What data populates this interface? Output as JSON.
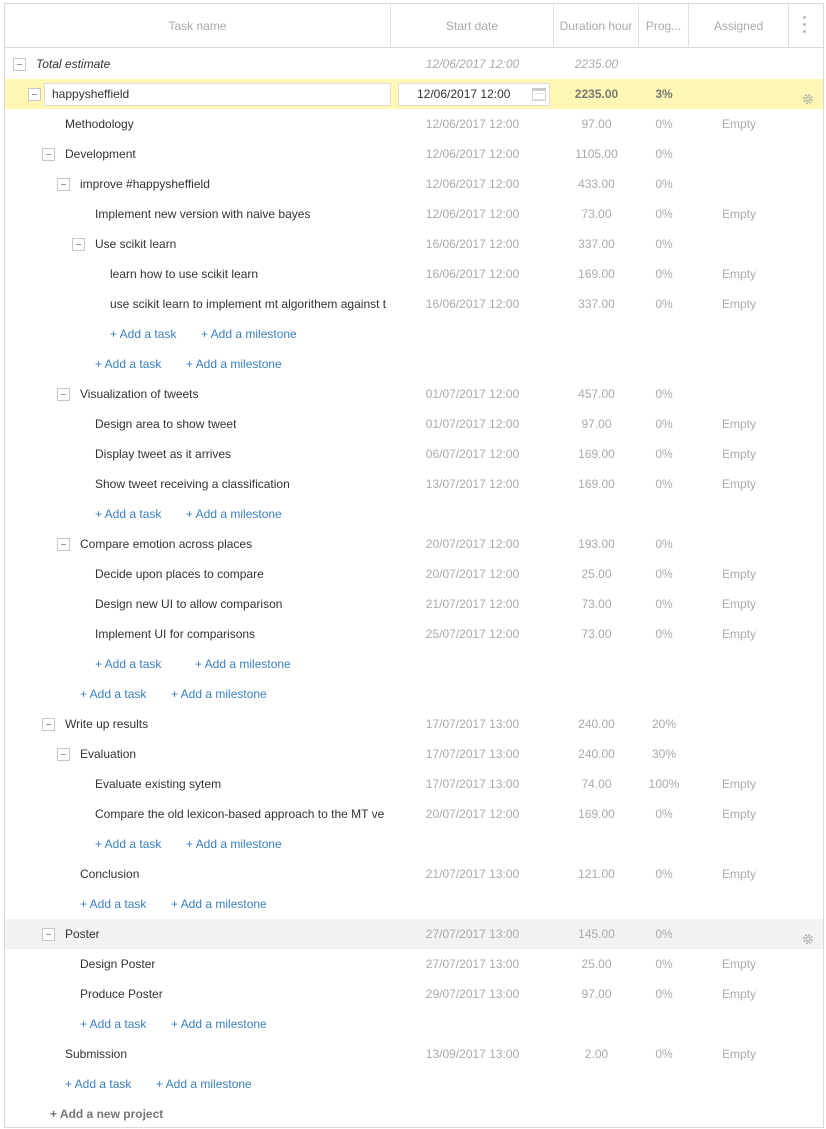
{
  "header": {
    "task_name": "Task name",
    "start_date": "Start date",
    "duration": "Duration hour",
    "progress": "Prog...",
    "assigned": "Assigned"
  },
  "total": {
    "name": "Total estimate",
    "start": "12/06/2017 12:00",
    "duration": "2235.00"
  },
  "project": {
    "name": "happysheffield",
    "start": "12/06/2017 12:00",
    "duration": "2235.00",
    "progress": "3%"
  },
  "tasks": [
    {
      "name": "Methodology",
      "start": "12/06/2017 12:00",
      "duration": "97.00",
      "progress": "0%",
      "assigned": "Empty"
    },
    {
      "name": "Development",
      "start": "12/06/2017 12:00",
      "duration": "1105.00",
      "progress": "0%",
      "assigned": ""
    },
    {
      "name": "improve #happysheffield",
      "start": "12/06/2017 12:00",
      "duration": "433.00",
      "progress": "0%",
      "assigned": ""
    },
    {
      "name": "Implement new version with naive bayes",
      "start": "12/06/2017 12:00",
      "duration": "73.00",
      "progress": "0%",
      "assigned": "Empty"
    },
    {
      "name": "Use scikit learn",
      "start": "16/06/2017 12:00",
      "duration": "337.00",
      "progress": "0%",
      "assigned": ""
    },
    {
      "name": "learn how to use scikit learn",
      "start": "16/06/2017 12:00",
      "duration": "169.00",
      "progress": "0%",
      "assigned": "Empty"
    },
    {
      "name": "use scikit learn to implement mt algorithem against t",
      "start": "16/06/2017 12:00",
      "duration": "337.00",
      "progress": "0%",
      "assigned": "Empty"
    },
    {
      "name": "Visualization of tweets",
      "start": "01/07/2017 12:00",
      "duration": "457.00",
      "progress": "0%",
      "assigned": ""
    },
    {
      "name": "Design area to show tweet",
      "start": "01/07/2017 12:00",
      "duration": "97.00",
      "progress": "0%",
      "assigned": "Empty"
    },
    {
      "name": "Display tweet as it arrives",
      "start": "06/07/2017 12:00",
      "duration": "169.00",
      "progress": "0%",
      "assigned": "Empty"
    },
    {
      "name": "Show tweet receiving a classification",
      "start": "13/07/2017 12:00",
      "duration": "169.00",
      "progress": "0%",
      "assigned": "Empty"
    },
    {
      "name": "Compare emotion across places",
      "start": "20/07/2017 12:00",
      "duration": "193.00",
      "progress": "0%",
      "assigned": ""
    },
    {
      "name": "Decide upon places to compare",
      "start": "20/07/2017 12:00",
      "duration": "25.00",
      "progress": "0%",
      "assigned": "Empty"
    },
    {
      "name": "Design new UI to allow comparison",
      "start": "21/07/2017 12:00",
      "duration": "73.00",
      "progress": "0%",
      "assigned": "Empty"
    },
    {
      "name": "Implement UI for comparisons",
      "start": "25/07/2017 12:00",
      "duration": "73.00",
      "progress": "0%",
      "assigned": "Empty"
    },
    {
      "name": "Write up results",
      "start": "17/07/2017 13:00",
      "duration": "240.00",
      "progress": "20%",
      "assigned": ""
    },
    {
      "name": "Evaluation",
      "start": "17/07/2017 13:00",
      "duration": "240.00",
      "progress": "30%",
      "assigned": ""
    },
    {
      "name": "Evaluate existing sytem",
      "start": "17/07/2017 13:00",
      "duration": "74.00",
      "progress": "100%",
      "assigned": "Empty"
    },
    {
      "name": "Compare the old lexicon-based approach to the MT ve",
      "start": "20/07/2017 12:00",
      "duration": "169.00",
      "progress": "0%",
      "assigned": "Empty"
    },
    {
      "name": "Conclusion",
      "start": "21/07/2017 13:00",
      "duration": "121.00",
      "progress": "0%",
      "assigned": "Empty"
    },
    {
      "name": "Poster",
      "start": "27/07/2017 13:00",
      "duration": "145.00",
      "progress": "0%",
      "assigned": ""
    },
    {
      "name": "Design Poster",
      "start": "27/07/2017 13:00",
      "duration": "25.00",
      "progress": "0%",
      "assigned": "Empty"
    },
    {
      "name": "Produce Poster",
      "start": "29/07/2017 13:00",
      "duration": "97.00",
      "progress": "0%",
      "assigned": "Empty"
    },
    {
      "name": "Submission",
      "start": "13/09/2017 13:00",
      "duration": "2.00",
      "progress": "0%",
      "assigned": "Empty"
    }
  ],
  "links": {
    "add_task": "+ Add a task",
    "add_milestone": "+ Add a milestone",
    "add_project": "+ Add a new project"
  },
  "icons": {
    "toggle": "collapse-icon",
    "gear": "gear-icon",
    "calendar": "calendar-icon",
    "menu": "kebab-menu-icon"
  },
  "colors": {
    "highlight": "#fff7b3",
    "link": "#3a7fc1",
    "selected_row": "#f2f2f2"
  }
}
